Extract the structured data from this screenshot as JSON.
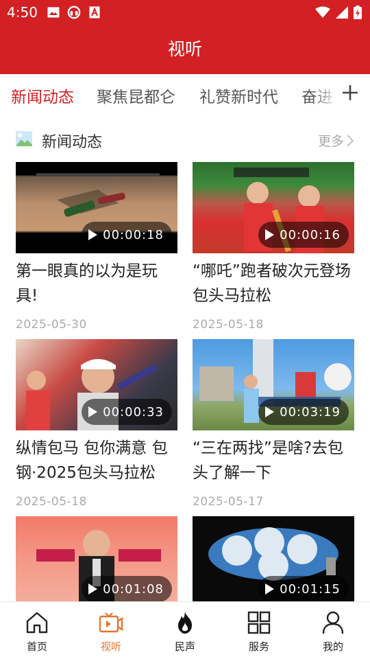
{
  "status_bar": {
    "time": "4:50"
  },
  "header": {
    "title": "视听"
  },
  "tabs": [
    {
      "label": "新闻动态",
      "active": true
    },
    {
      "label": "聚焦昆都仑",
      "active": false
    },
    {
      "label": "礼赞新时代",
      "active": false
    },
    {
      "label": "奋进",
      "active": false
    }
  ],
  "section": {
    "title": "新闻动态",
    "more_label": "更多"
  },
  "videos": [
    {
      "title": "第一眼真的以为是玩具!",
      "date": "2025-05-30",
      "duration": "00:00:18"
    },
    {
      "title": "“哪吒”跑者破次元登场包头马拉松",
      "date": "2025-05-18",
      "duration": "00:00:16"
    },
    {
      "title": "纵情包马 包你满意 包钢·2025包头马拉松",
      "date": "2025-05-18",
      "duration": "00:00:33"
    },
    {
      "title": "“三在两找”是啥?去包头了解一下",
      "date": "2025-05-17",
      "duration": "00:03:19"
    },
    {
      "title": "",
      "date": "",
      "duration": "00:01:08"
    },
    {
      "title": "",
      "date": "",
      "duration": "00:01:15"
    }
  ],
  "bottom_nav": [
    {
      "label": "首页",
      "icon": "home-icon",
      "active": false
    },
    {
      "label": "视听",
      "icon": "video-icon",
      "active": true
    },
    {
      "label": "民声",
      "icon": "flame-icon",
      "active": false
    },
    {
      "label": "服务",
      "icon": "grid-icon",
      "active": false
    },
    {
      "label": "我的",
      "icon": "user-icon",
      "active": false
    }
  ],
  "colors": {
    "brand": "#d32024",
    "nav_active": "#e8762c",
    "muted": "#aaaaaa"
  }
}
